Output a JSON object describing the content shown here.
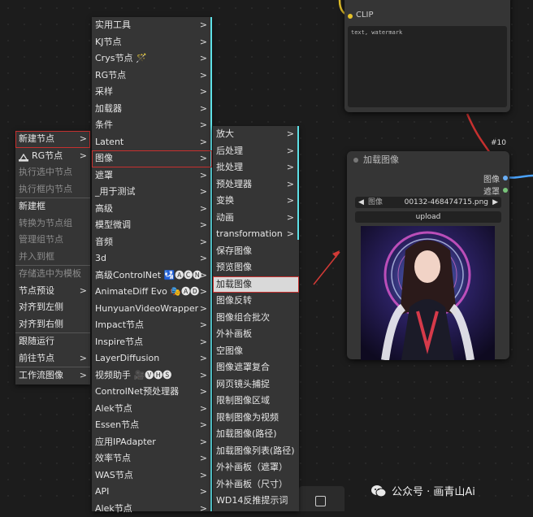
{
  "canvas": {
    "clip_node": {
      "clip_label": "CLIP",
      "text_value": "text, watermark"
    },
    "link_tag": "#10",
    "load_image_node": {
      "title": "加载图像",
      "output_image": "图像",
      "output_mask": "遮罩",
      "image_widget_label": "图像",
      "image_widget_value": "00132-468474715.png",
      "upload_label": "upload"
    },
    "watermark": "公众号 · 画青山Ai"
  },
  "menu1": {
    "items": [
      {
        "label": "新建节点",
        "arrow": ">"
      },
      {
        "label": "RG节点",
        "arrow": ">"
      },
      {
        "label": "执行选中节点"
      },
      {
        "label": "执行框内节点"
      },
      {
        "label": "新建框"
      },
      {
        "label": "转换为节点组"
      },
      {
        "label": "管理组节点"
      },
      {
        "label": "并入到框"
      },
      {
        "label": "存储选中为模板"
      },
      {
        "label": "节点预设",
        "arrow": ">"
      },
      {
        "label": "对齐到左侧"
      },
      {
        "label": "对齐到右侧"
      },
      {
        "label": "跟随运行"
      },
      {
        "label": "前往节点",
        "arrow": ">"
      },
      {
        "label": "工作流图像",
        "arrow": ">"
      }
    ]
  },
  "menu2": {
    "items": [
      {
        "label": "实用工具"
      },
      {
        "label": "KJ节点"
      },
      {
        "label": "Crys节点 🪄"
      },
      {
        "label": "RG节点"
      },
      {
        "label": "采样"
      },
      {
        "label": "加载器"
      },
      {
        "label": "条件"
      },
      {
        "label": "Latent"
      },
      {
        "label": "图像"
      },
      {
        "label": "遮罩"
      },
      {
        "label": "_用于测试"
      },
      {
        "label": "高级"
      },
      {
        "label": "模型微调"
      },
      {
        "label": "音频"
      },
      {
        "label": "3d"
      },
      {
        "label": "高级ControlNet 🛂🅐🅒🅝"
      },
      {
        "label": "AnimateDiff Evo 🎭🅐🅓"
      },
      {
        "label": "HunyuanVideoWrapper"
      },
      {
        "label": "Impact节点"
      },
      {
        "label": "Inspire节点"
      },
      {
        "label": "LayerDiffusion"
      },
      {
        "label": "视频助手 🎥🅥🅗🅢"
      },
      {
        "label": "ControlNet预处理器"
      },
      {
        "label": "Alek节点"
      },
      {
        "label": "Essen节点"
      },
      {
        "label": "应用IPAdapter"
      },
      {
        "label": "效率节点"
      },
      {
        "label": "WAS节点"
      },
      {
        "label": "API"
      },
      {
        "label": "Alek节点"
      }
    ],
    "arrow": ">"
  },
  "menu3": {
    "items": [
      {
        "label": "放大",
        "arrow": ">"
      },
      {
        "label": "后处理",
        "arrow": ">"
      },
      {
        "label": "批处理",
        "arrow": ">"
      },
      {
        "label": "预处理器",
        "arrow": ">"
      },
      {
        "label": "变换",
        "arrow": ">"
      },
      {
        "label": "动画",
        "arrow": ">"
      },
      {
        "label": "transformation",
        "arrow": ">"
      },
      {
        "label": "保存图像"
      },
      {
        "label": "预览图像"
      },
      {
        "label": "加载图像"
      },
      {
        "label": "图像反转"
      },
      {
        "label": "图像组合批次"
      },
      {
        "label": "外补画板"
      },
      {
        "label": "空图像"
      },
      {
        "label": "图像遮罩复合"
      },
      {
        "label": "网页镜头捕捉"
      },
      {
        "label": "限制图像区域"
      },
      {
        "label": "限制图像为视频"
      },
      {
        "label": "加载图像(路径)"
      },
      {
        "label": "加载图像列表(路径)"
      },
      {
        "label": "外补画板（遮罩）"
      },
      {
        "label": "外补画板（尺寸）"
      },
      {
        "label": "WD14反推提示词"
      }
    ]
  },
  "colors": {
    "highlight_border": "#c6302f",
    "accent_cyan": "#5ee0e6",
    "link_red": "#c6302f",
    "link_blue": "#4aa3ff",
    "link_yellow": "#e6c229"
  }
}
